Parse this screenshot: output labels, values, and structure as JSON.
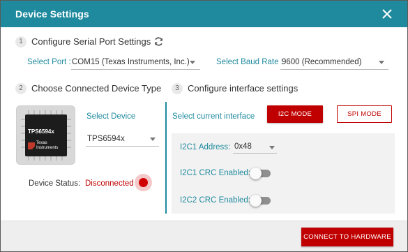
{
  "dialog": {
    "title": "Device Settings"
  },
  "step1": {
    "number": "1",
    "title": "Configure Serial Port Settings",
    "port_label": "Select Port :",
    "port_value": "COM15 (Texas Instruments, Inc.)",
    "baud_label": "Select Baud Rate :",
    "baud_value": "9600 (Recommended)"
  },
  "step2": {
    "number": "2",
    "title": "Choose Connected Device Type",
    "select_device_label": "Select Device",
    "device_value": "TPS6594x",
    "chip_name": "TPS6594x",
    "chip_brand_line1": "Texas",
    "chip_brand_line2": "Instruments",
    "status_label": "Device Status:",
    "status_value": "Disconnected"
  },
  "step3": {
    "number": "3",
    "title": "Configure interface settings",
    "current_interface_label": "Select current interface",
    "i2c_button": "I2C MODE",
    "spi_button": "SPI MODE",
    "i2c1_address_label": "I2C1 Address:",
    "i2c1_address_value": "0x48",
    "i2c1_crc_label": "I2C1 CRC Enabled:",
    "i2c1_crc_enabled": false,
    "i2c2_crc_label": "I2C2 CRC Enabled:",
    "i2c2_crc_enabled": false
  },
  "footer": {
    "connect_button": "CONNECT TO HARDWARE"
  },
  "colors": {
    "accent": "#1f8a9e",
    "danger": "#c00000",
    "status_dot": "#d10000"
  }
}
